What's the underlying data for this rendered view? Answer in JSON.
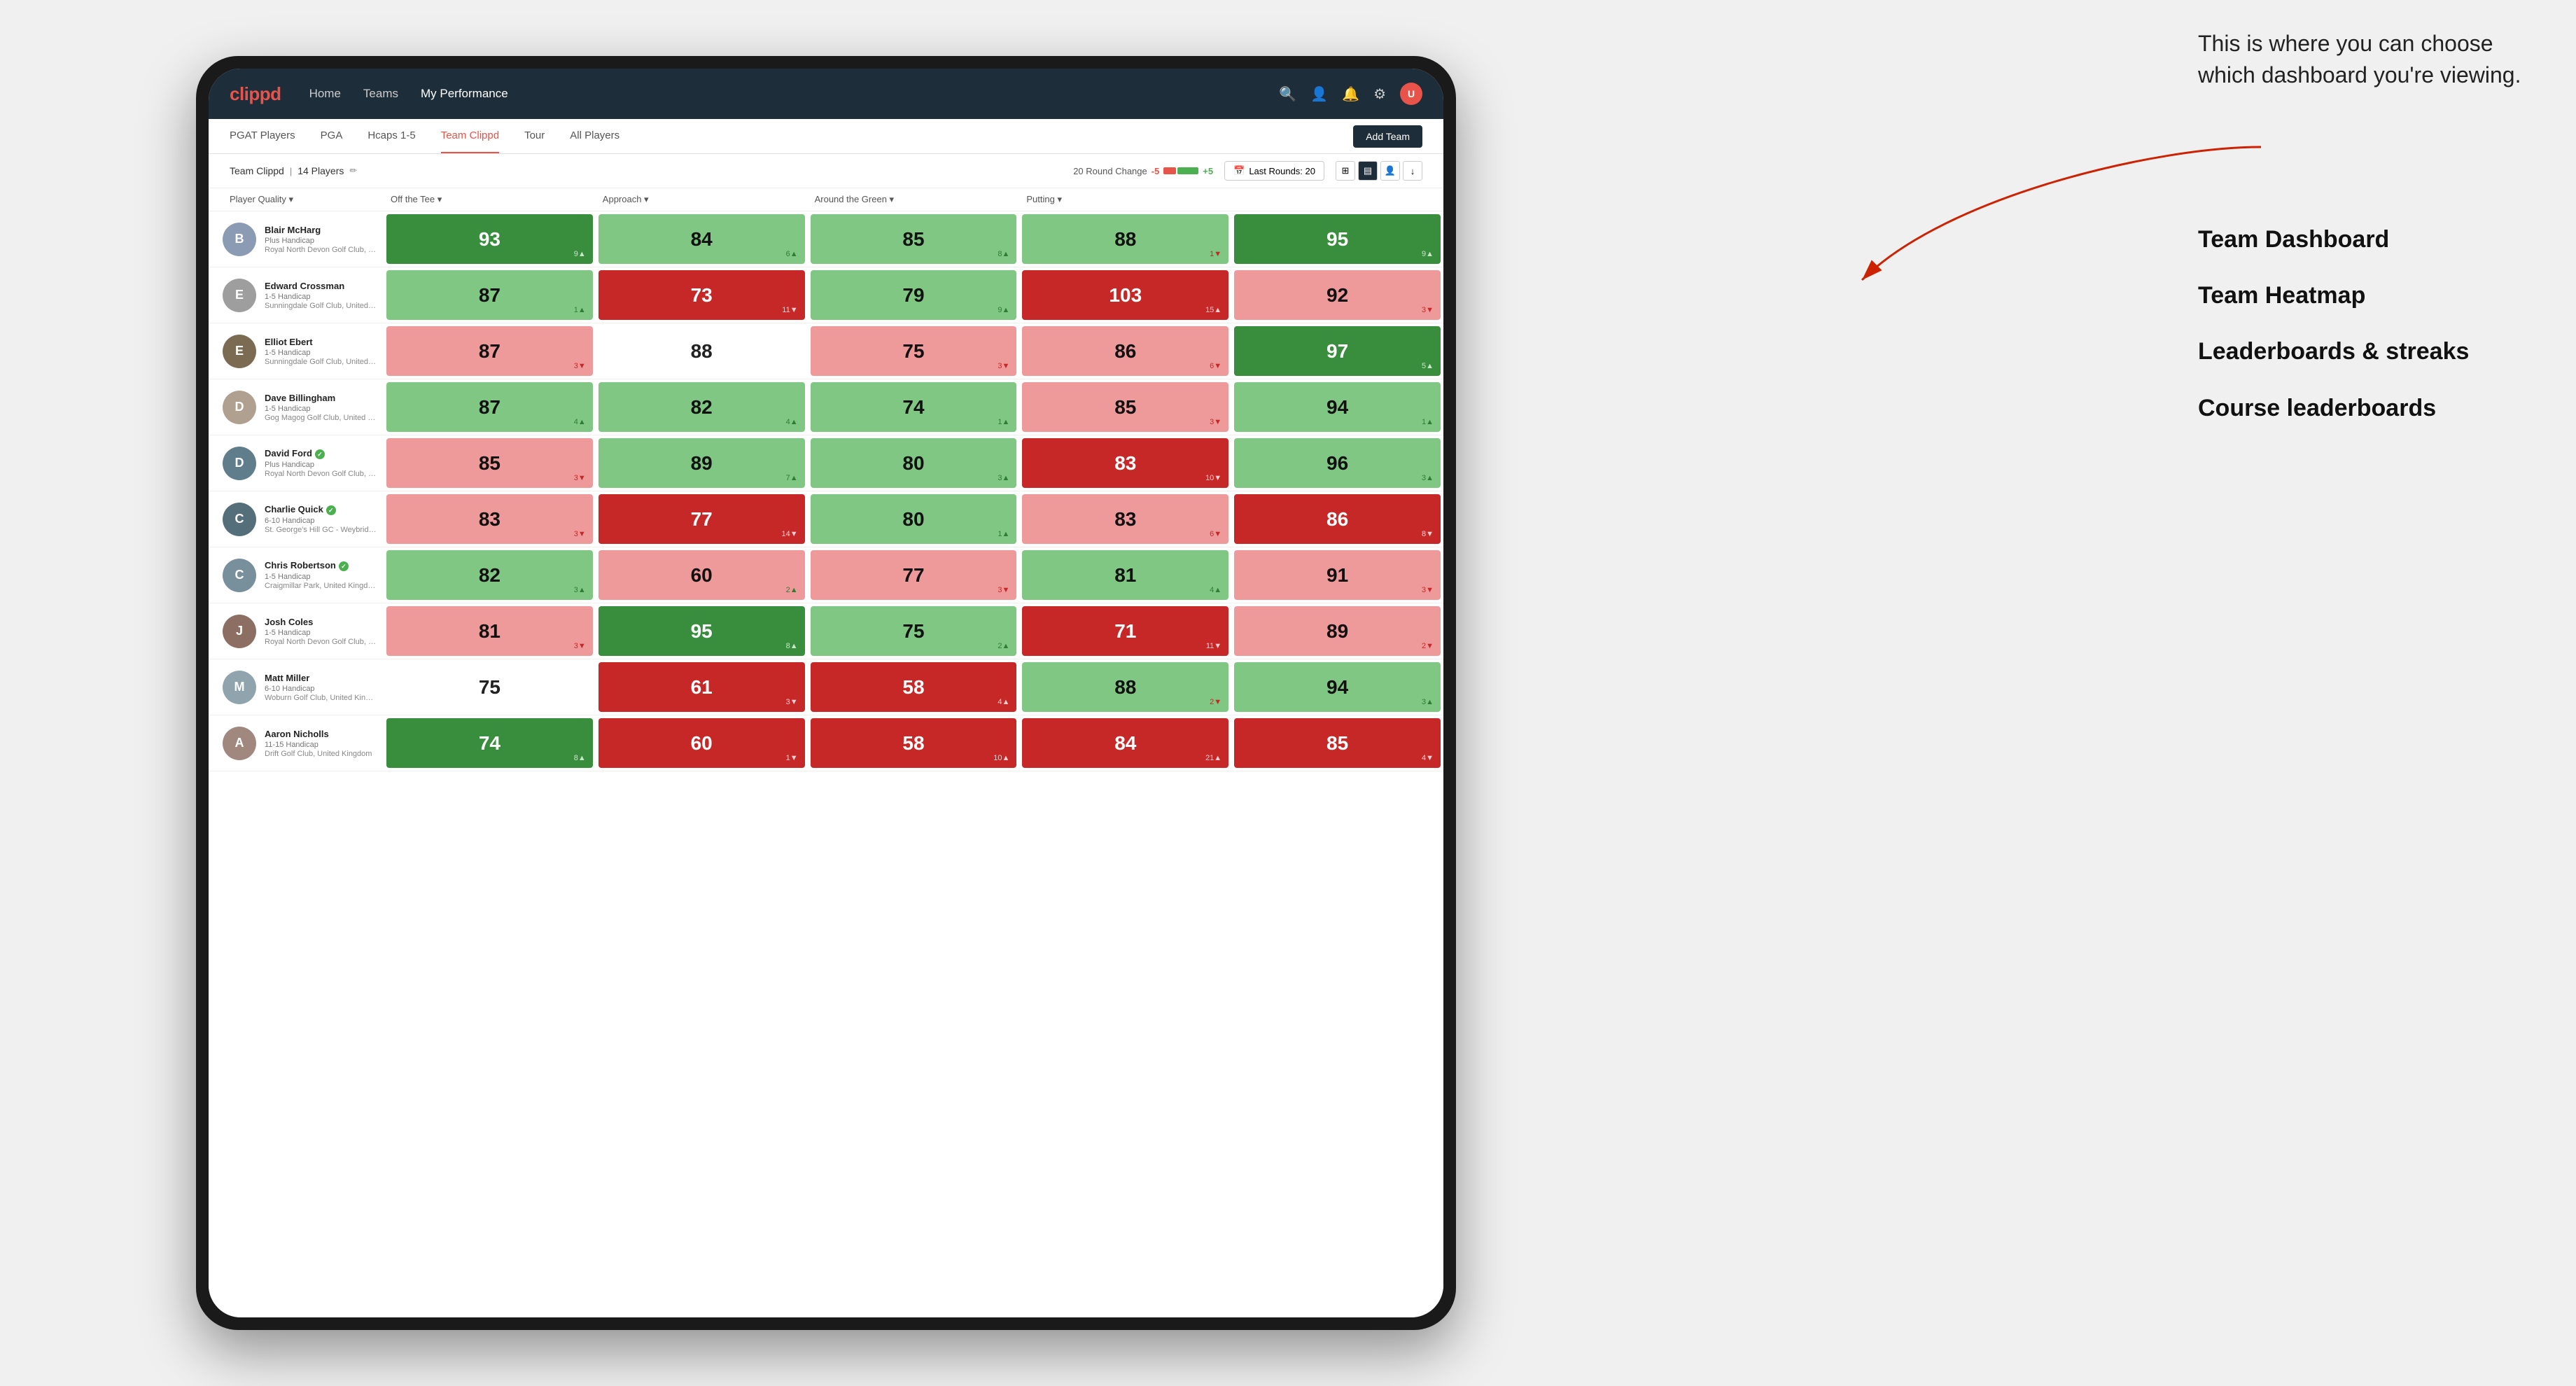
{
  "annotation": {
    "text": "This is where you can choose which dashboard you're viewing.",
    "options": [
      {
        "label": "Team Dashboard"
      },
      {
        "label": "Team Heatmap"
      },
      {
        "label": "Leaderboards & streaks"
      },
      {
        "label": "Course leaderboards"
      }
    ]
  },
  "nav": {
    "logo": "clippd",
    "links": [
      "Home",
      "Teams",
      "My Performance"
    ],
    "active_link": "My Performance"
  },
  "sub_nav": {
    "links": [
      "PGAT Players",
      "PGA",
      "Hcaps 1-5",
      "Team Clippd",
      "Tour",
      "All Players"
    ],
    "active_link": "Team Clippd",
    "add_team_label": "Add Team"
  },
  "team_header": {
    "name": "Team Clippd",
    "player_count": "14 Players",
    "round_change_label": "20 Round Change",
    "minus_label": "-5",
    "plus_label": "+5",
    "last_rounds_label": "Last Rounds: 20"
  },
  "table": {
    "columns": [
      {
        "label": "Player Quality ▾"
      },
      {
        "label": "Off the Tee ▾"
      },
      {
        "label": "Approach ▾"
      },
      {
        "label": "Around the Green ▾"
      },
      {
        "label": "Putting ▾"
      }
    ],
    "rows": [
      {
        "name": "Blair McHarg",
        "handicap": "Plus Handicap",
        "club": "Royal North Devon Golf Club, United Kingdom",
        "avatar_color": "#8B9BB4",
        "avatar_text": "B",
        "scores": [
          {
            "value": "93",
            "change": "9▲",
            "change_dir": "up",
            "color": "green-dark"
          },
          {
            "value": "84",
            "change": "6▲",
            "change_dir": "up",
            "color": "green-light"
          },
          {
            "value": "85",
            "change": "8▲",
            "change_dir": "up",
            "color": "green-light"
          },
          {
            "value": "88",
            "change": "1▼",
            "change_dir": "down",
            "color": "green-light"
          },
          {
            "value": "95",
            "change": "9▲",
            "change_dir": "up",
            "color": "green-dark"
          }
        ]
      },
      {
        "name": "Edward Crossman",
        "handicap": "1-5 Handicap",
        "club": "Sunningdale Golf Club, United Kingdom",
        "avatar_color": "#9e9e9e",
        "avatar_text": "E",
        "scores": [
          {
            "value": "87",
            "change": "1▲",
            "change_dir": "up",
            "color": "green-light"
          },
          {
            "value": "73",
            "change": "11▼",
            "change_dir": "down",
            "color": "red-dark"
          },
          {
            "value": "79",
            "change": "9▲",
            "change_dir": "up",
            "color": "green-light"
          },
          {
            "value": "103",
            "change": "15▲",
            "change_dir": "up",
            "color": "red-dark"
          },
          {
            "value": "92",
            "change": "3▼",
            "change_dir": "down",
            "color": "red-light"
          }
        ]
      },
      {
        "name": "Elliot Ebert",
        "handicap": "1-5 Handicap",
        "club": "Sunningdale Golf Club, United Kingdom",
        "avatar_color": "#7b6b52",
        "avatar_text": "E",
        "scores": [
          {
            "value": "87",
            "change": "3▼",
            "change_dir": "down",
            "color": "red-light"
          },
          {
            "value": "88",
            "change": "",
            "change_dir": "",
            "color": "neutral"
          },
          {
            "value": "75",
            "change": "3▼",
            "change_dir": "down",
            "color": "red-light"
          },
          {
            "value": "86",
            "change": "6▼",
            "change_dir": "down",
            "color": "red-light"
          },
          {
            "value": "97",
            "change": "5▲",
            "change_dir": "up",
            "color": "green-dark"
          }
        ]
      },
      {
        "name": "Dave Billingham",
        "handicap": "1-5 Handicap",
        "club": "Gog Magog Golf Club, United Kingdom",
        "avatar_color": "#b0a090",
        "avatar_text": "D",
        "scores": [
          {
            "value": "87",
            "change": "4▲",
            "change_dir": "up",
            "color": "green-light"
          },
          {
            "value": "82",
            "change": "4▲",
            "change_dir": "up",
            "color": "green-light"
          },
          {
            "value": "74",
            "change": "1▲",
            "change_dir": "up",
            "color": "green-light"
          },
          {
            "value": "85",
            "change": "3▼",
            "change_dir": "down",
            "color": "red-light"
          },
          {
            "value": "94",
            "change": "1▲",
            "change_dir": "up",
            "color": "green-light"
          }
        ]
      },
      {
        "name": "David Ford",
        "handicap": "Plus Handicap",
        "club": "Royal North Devon Golf Club, United Kingdom",
        "avatar_color": "#607d8b",
        "avatar_text": "D",
        "verified": true,
        "scores": [
          {
            "value": "85",
            "change": "3▼",
            "change_dir": "down",
            "color": "red-light"
          },
          {
            "value": "89",
            "change": "7▲",
            "change_dir": "up",
            "color": "green-light"
          },
          {
            "value": "80",
            "change": "3▲",
            "change_dir": "up",
            "color": "green-light"
          },
          {
            "value": "83",
            "change": "10▼",
            "change_dir": "down",
            "color": "red-dark"
          },
          {
            "value": "96",
            "change": "3▲",
            "change_dir": "up",
            "color": "green-light"
          }
        ]
      },
      {
        "name": "Charlie Quick",
        "handicap": "6-10 Handicap",
        "club": "St. George's Hill GC - Weybridge - Surrey, Uni...",
        "avatar_color": "#546e7a",
        "avatar_text": "C",
        "verified": true,
        "scores": [
          {
            "value": "83",
            "change": "3▼",
            "change_dir": "down",
            "color": "red-light"
          },
          {
            "value": "77",
            "change": "14▼",
            "change_dir": "down",
            "color": "red-dark"
          },
          {
            "value": "80",
            "change": "1▲",
            "change_dir": "up",
            "color": "green-light"
          },
          {
            "value": "83",
            "change": "6▼",
            "change_dir": "down",
            "color": "red-light"
          },
          {
            "value": "86",
            "change": "8▼",
            "change_dir": "down",
            "color": "red-dark"
          }
        ]
      },
      {
        "name": "Chris Robertson",
        "handicap": "1-5 Handicap",
        "club": "Craigmillar Park, United Kingdom",
        "avatar_color": "#78909c",
        "avatar_text": "C",
        "verified": true,
        "scores": [
          {
            "value": "82",
            "change": "3▲",
            "change_dir": "up",
            "color": "green-light"
          },
          {
            "value": "60",
            "change": "2▲",
            "change_dir": "up",
            "color": "red-light"
          },
          {
            "value": "77",
            "change": "3▼",
            "change_dir": "down",
            "color": "red-light"
          },
          {
            "value": "81",
            "change": "4▲",
            "change_dir": "up",
            "color": "green-light"
          },
          {
            "value": "91",
            "change": "3▼",
            "change_dir": "down",
            "color": "red-light"
          }
        ]
      },
      {
        "name": "Josh Coles",
        "handicap": "1-5 Handicap",
        "club": "Royal North Devon Golf Club, United Kingdom",
        "avatar_color": "#8d6e63",
        "avatar_text": "J",
        "scores": [
          {
            "value": "81",
            "change": "3▼",
            "change_dir": "down",
            "color": "red-light"
          },
          {
            "value": "95",
            "change": "8▲",
            "change_dir": "up",
            "color": "green-dark"
          },
          {
            "value": "75",
            "change": "2▲",
            "change_dir": "up",
            "color": "green-light"
          },
          {
            "value": "71",
            "change": "11▼",
            "change_dir": "down",
            "color": "red-dark"
          },
          {
            "value": "89",
            "change": "2▼",
            "change_dir": "down",
            "color": "red-light"
          }
        ]
      },
      {
        "name": "Matt Miller",
        "handicap": "6-10 Handicap",
        "club": "Woburn Golf Club, United Kingdom",
        "avatar_color": "#90a4ae",
        "avatar_text": "M",
        "scores": [
          {
            "value": "75",
            "change": "",
            "change_dir": "",
            "color": "neutral"
          },
          {
            "value": "61",
            "change": "3▼",
            "change_dir": "down",
            "color": "red-dark"
          },
          {
            "value": "58",
            "change": "4▲",
            "change_dir": "up",
            "color": "red-dark"
          },
          {
            "value": "88",
            "change": "2▼",
            "change_dir": "down",
            "color": "green-light"
          },
          {
            "value": "94",
            "change": "3▲",
            "change_dir": "up",
            "color": "green-light"
          }
        ]
      },
      {
        "name": "Aaron Nicholls",
        "handicap": "11-15 Handicap",
        "club": "Drift Golf Club, United Kingdom",
        "avatar_color": "#a1887f",
        "avatar_text": "A",
        "scores": [
          {
            "value": "74",
            "change": "8▲",
            "change_dir": "up",
            "color": "green-dark"
          },
          {
            "value": "60",
            "change": "1▼",
            "change_dir": "down",
            "color": "red-dark"
          },
          {
            "value": "58",
            "change": "10▲",
            "change_dir": "up",
            "color": "red-dark"
          },
          {
            "value": "84",
            "change": "21▲",
            "change_dir": "up",
            "color": "red-dark"
          },
          {
            "value": "85",
            "change": "4▼",
            "change_dir": "down",
            "color": "red-dark"
          }
        ]
      }
    ]
  }
}
